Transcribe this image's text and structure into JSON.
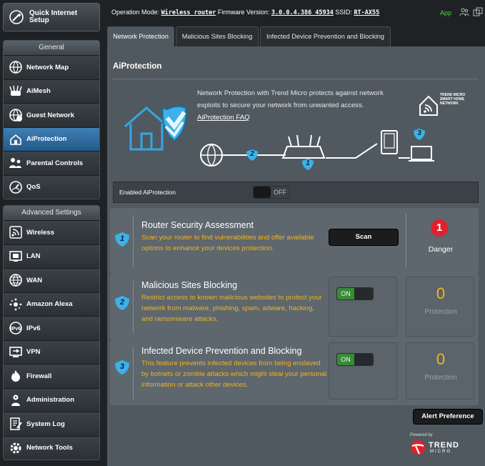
{
  "sidebar": {
    "quick_setup": "Quick Internet Setup",
    "general_heading": "General",
    "general_items": [
      {
        "label": "Network Map",
        "icon": "network-map-icon"
      },
      {
        "label": "AiMesh",
        "icon": "aimesh-icon"
      },
      {
        "label": "Guest Network",
        "icon": "guest-network-icon"
      },
      {
        "label": "AiProtection",
        "icon": "aiprotection-icon",
        "active": true
      },
      {
        "label": "Parental Controls",
        "icon": "parental-controls-icon"
      },
      {
        "label": "QoS",
        "icon": "qos-icon"
      }
    ],
    "advanced_heading": "Advanced Settings",
    "advanced_items": [
      {
        "label": "Wireless",
        "icon": "wireless-icon"
      },
      {
        "label": "LAN",
        "icon": "lan-icon"
      },
      {
        "label": "WAN",
        "icon": "wan-icon"
      },
      {
        "label": "Amazon Alexa",
        "icon": "alexa-icon"
      },
      {
        "label": "IPv6",
        "icon": "ipv6-icon"
      },
      {
        "label": "VPN",
        "icon": "vpn-icon"
      },
      {
        "label": "Firewall",
        "icon": "firewall-icon"
      },
      {
        "label": "Administration",
        "icon": "administration-icon"
      },
      {
        "label": "System Log",
        "icon": "system-log-icon"
      },
      {
        "label": "Network Tools",
        "icon": "network-tools-icon"
      }
    ]
  },
  "topbar": {
    "mode_label": "Operation Mode:",
    "mode_value": "Wireless router",
    "fw_label": "Firmware Version:",
    "fw_value": "3.0.0.4.386_45934",
    "ssid_label": "SSID:",
    "ssid_value": "RT-AX55",
    "app_label": "App"
  },
  "tabs": [
    "Network Protection",
    "Malicious Sites Blocking",
    "Infected Device Prevention and Blocking"
  ],
  "page": {
    "title": "AiProtection",
    "description": "Network Protection with Trend Micro protects against network exploits to secure your network from unwanted access.",
    "faq_link": "AiProtection FAQ",
    "trend_logo_text": "TREND MICRO SMART HOME NETWORK",
    "diagram_numbers": [
      "1",
      "2",
      "3"
    ],
    "enabled_label": "Enabled AiProtection",
    "enabled_state": "OFF"
  },
  "cards": [
    {
      "number": "1",
      "title": "Router Security Assessment",
      "description": "Scan your router to find vulnerabilities and offer available options to enhance your devices protection.",
      "button": "Scan",
      "badge_count": "1",
      "status": "Danger"
    },
    {
      "number": "2",
      "title": "Malicious Sites Blocking",
      "description": "Restrict access to known malicious websites to protect your network from malware, phishing, spam, adware, hacking, and ransomware attacks.",
      "toggle": "ON",
      "count": "0",
      "count_label": "Protection"
    },
    {
      "number": "3",
      "title": "Infected Device Prevention and Blocking",
      "description": "This feature prevents infected devices from being enslaved by botnets or zombie attacks which might steal your personal information or attack other devices.",
      "toggle": "ON",
      "count": "0",
      "count_label": "Protection"
    }
  ],
  "footer": {
    "alert_button": "Alert Preference",
    "powered_by": "Powered by",
    "trend_brand": "TREND",
    "trend_brand_sub": "MICRO"
  },
  "colors": {
    "accent_orange": "#f2b322",
    "active_blue": "#2f6ea3",
    "badge_red": "#e2202b",
    "on_green": "#3a8a37",
    "panel": "#50595f"
  }
}
